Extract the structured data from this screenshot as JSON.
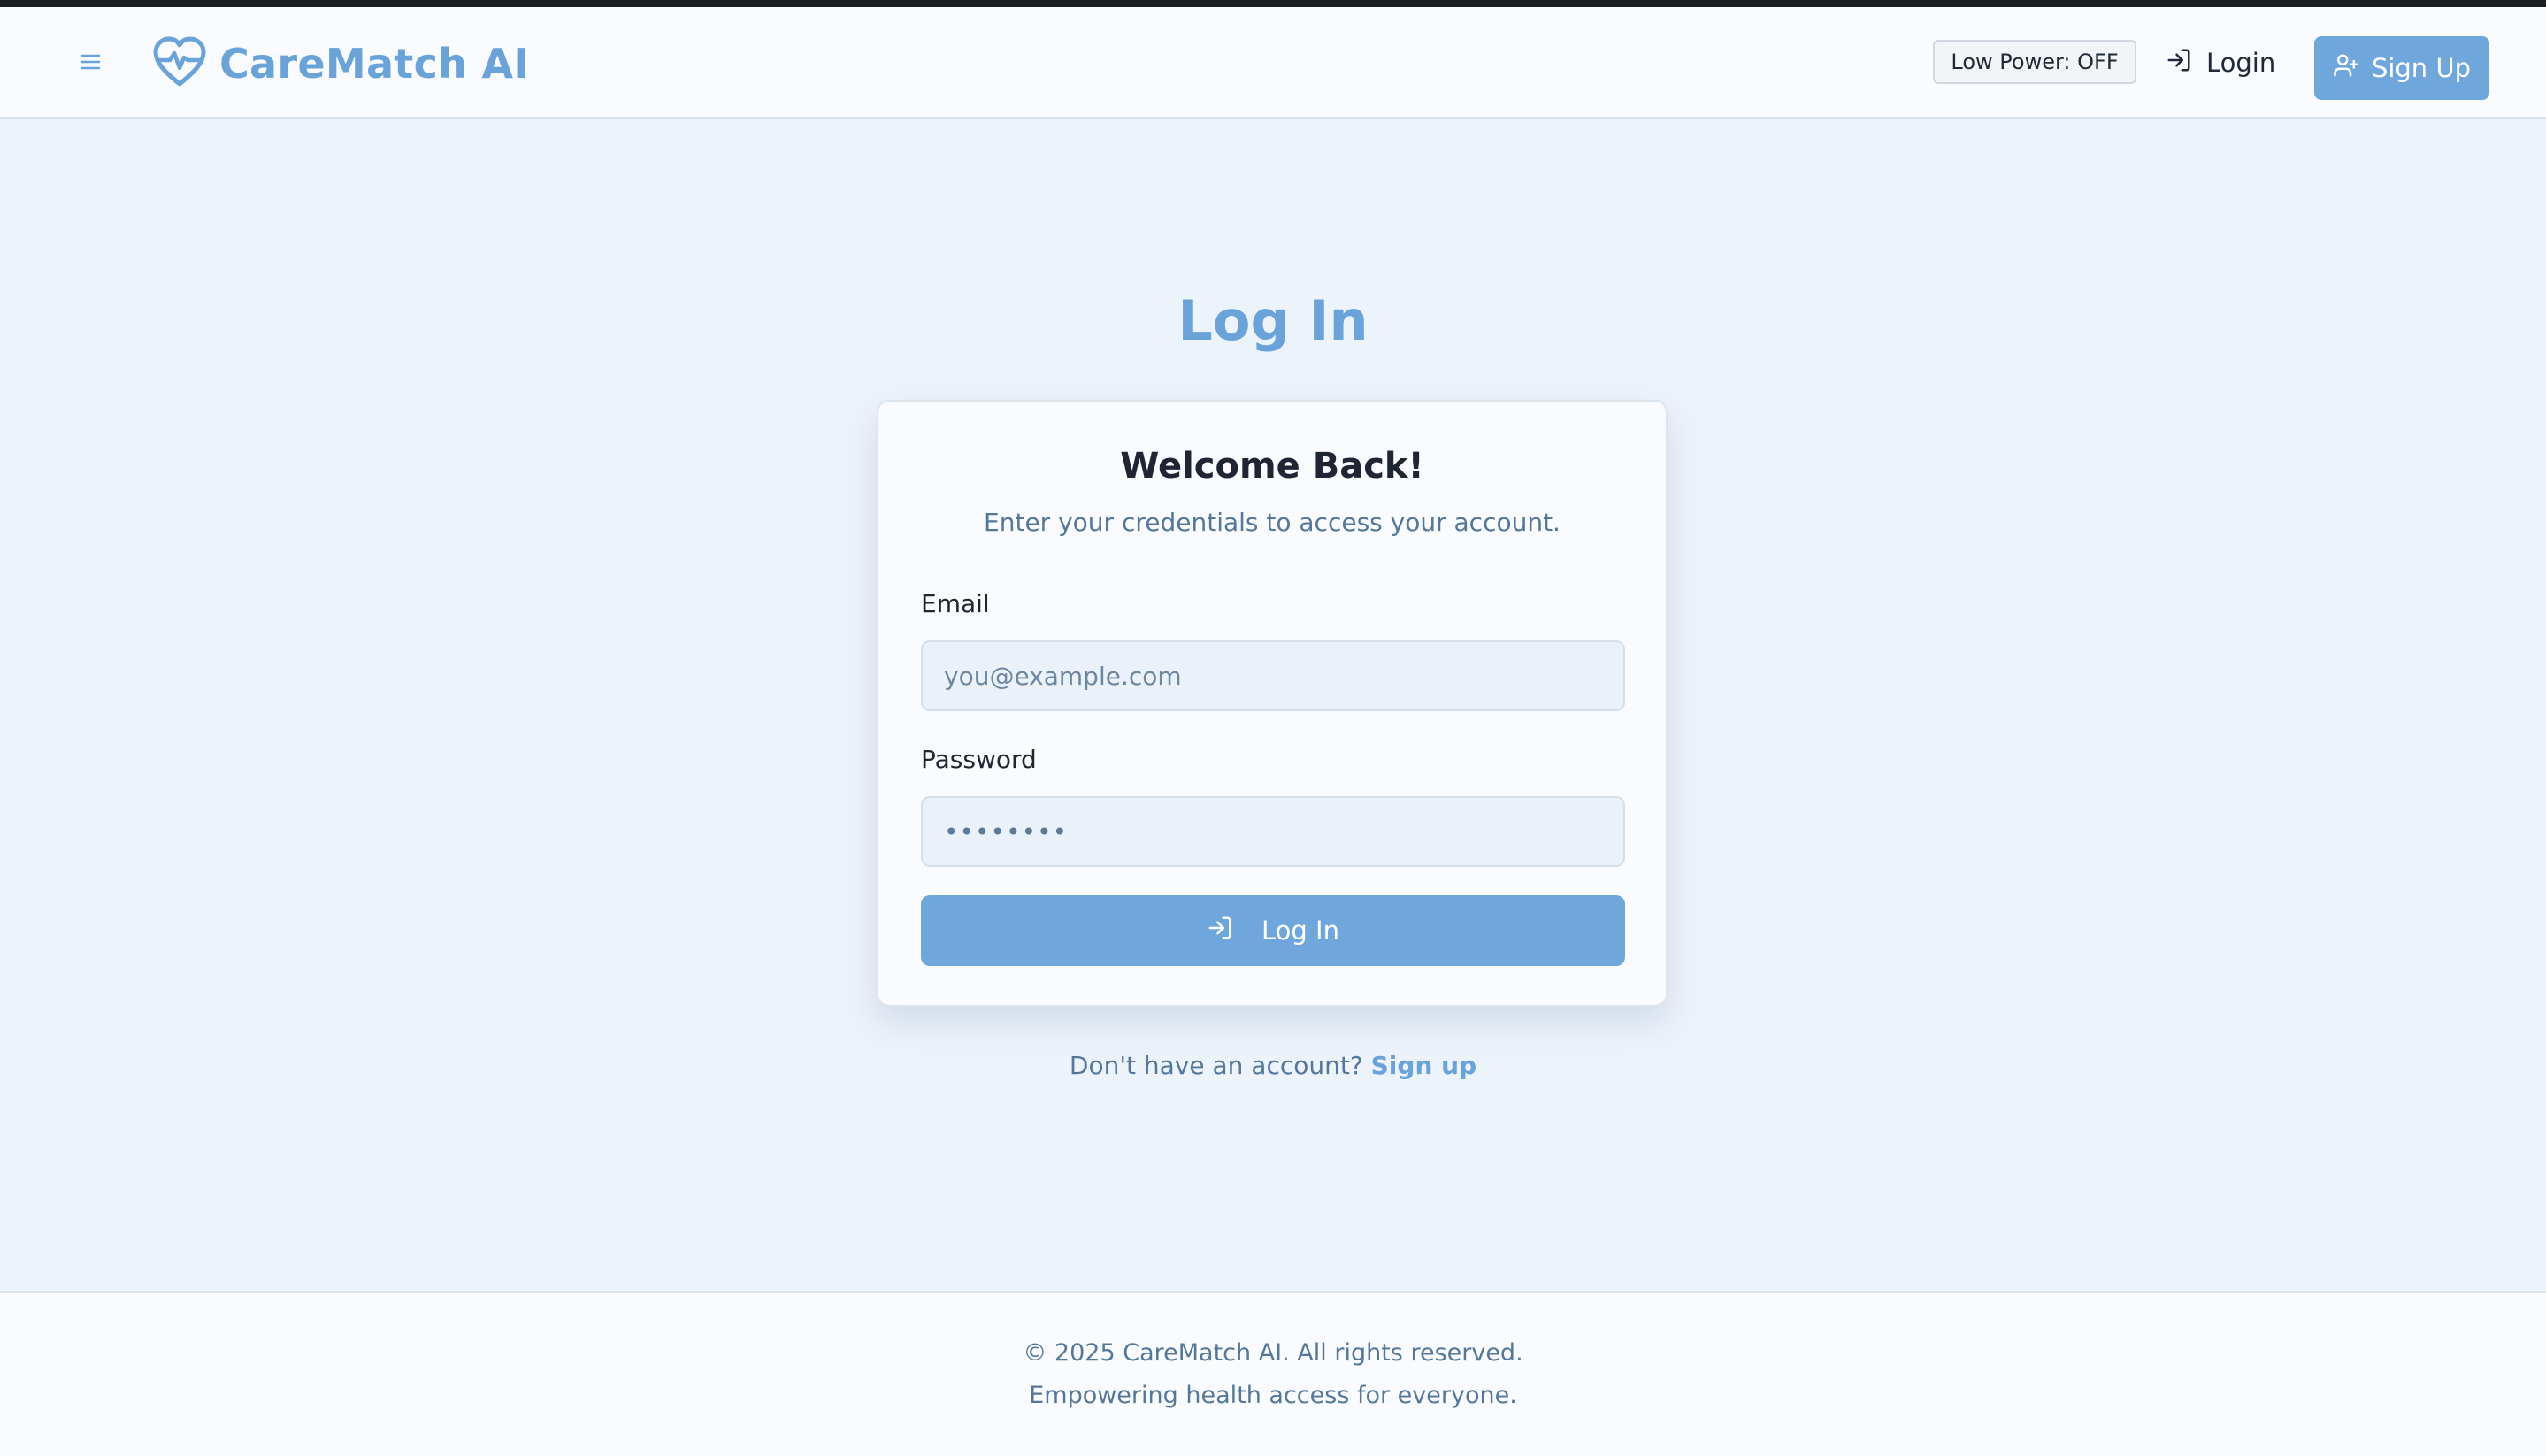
{
  "header": {
    "brand": "CareMatch AI",
    "low_power_label": "Low Power: OFF",
    "login_label": "Login",
    "signup_label": "Sign Up"
  },
  "main": {
    "title": "Log In",
    "card": {
      "title": "Welcome Back!",
      "subtitle": "Enter your credentials to access your account.",
      "email_label": "Email",
      "email_placeholder": "you@example.com",
      "email_value": "",
      "password_label": "Password",
      "password_value": "••••••••",
      "submit_label": "Log In"
    },
    "signup_prompt": "Don't have an account?",
    "signup_link": "Sign up"
  },
  "footer": {
    "copyright": "© 2025 CareMatch AI. All rights reserved.",
    "tagline": "Empowering health access for everyone."
  },
  "icons": {
    "menu": "menu-icon",
    "brand": "heart-pulse-icon",
    "login": "log-in-icon",
    "signup": "user-plus-icon"
  },
  "colors": {
    "accent": "#6fa6dc",
    "brand_text": "#6aa3d9",
    "page_bg": "#edf3fb",
    "muted_text": "#55779c"
  }
}
